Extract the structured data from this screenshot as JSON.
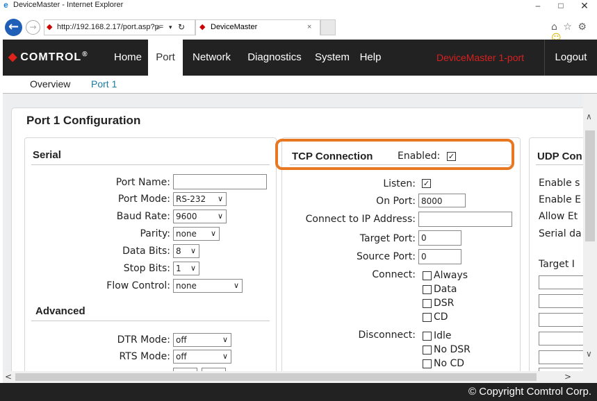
{
  "window": {
    "title": "DeviceMaster - Internet Explorer",
    "minimize": "–",
    "maximize": "□",
    "close": "✕"
  },
  "browser": {
    "url": "http://192.168.2.17/port.asp?p=",
    "search_glyph": "⌕",
    "dropdown_glyph": "▾",
    "refresh_glyph": "↻",
    "tab_label": "DeviceMaster",
    "tab_close": "×",
    "toolbar_icons": "⌂ ☆ ⚙"
  },
  "nav": {
    "logo": "COMTROL",
    "logo_sub": "®",
    "items": [
      {
        "label": "Home",
        "active": false
      },
      {
        "label": "Port",
        "active": true
      },
      {
        "label": "Network",
        "active": false
      },
      {
        "label": "Diagnostics",
        "active": false
      },
      {
        "label": "System",
        "active": false
      },
      {
        "label": "Help",
        "active": false
      }
    ],
    "device": "DeviceMaster 1-port",
    "logout": "Logout"
  },
  "subnav": {
    "overview": "Overview",
    "port": "Port 1"
  },
  "page": {
    "title": "Port 1 Configuration"
  },
  "serial": {
    "title": "Serial",
    "port_name_label": "Port Name:",
    "port_name_value": "",
    "port_mode_label": "Port Mode:",
    "port_mode_value": "RS-232",
    "baud_rate_label": "Baud Rate:",
    "baud_rate_value": "9600",
    "parity_label": "Parity:",
    "parity_value": "none",
    "data_bits_label": "Data Bits:",
    "data_bits_value": "8",
    "stop_bits_label": "Stop Bits:",
    "stop_bits_value": "1",
    "flow_control_label": "Flow Control:",
    "flow_control_value": "none",
    "advanced_title": "Advanced",
    "dtr_mode_label": "DTR Mode:",
    "dtr_mode_value": "off",
    "rts_mode_label": "RTS Mode:",
    "rts_mode_value": "off"
  },
  "tcp": {
    "title": "TCP Connection",
    "enabled_label": "Enabled:",
    "enabled": true,
    "listen_label": "Listen:",
    "listen": true,
    "on_port_label": "On Port:",
    "on_port_value": "8000",
    "connect_ip_label": "Connect to IP Address:",
    "connect_ip_value": "",
    "target_port_label": "Target Port:",
    "target_port_value": "0",
    "source_port_label": "Source Port:",
    "source_port_value": "0",
    "connect_label": "Connect:",
    "connect_options": [
      {
        "label": "Always",
        "checked": false
      },
      {
        "label": "Data",
        "checked": false
      },
      {
        "label": "DSR",
        "checked": false
      },
      {
        "label": "CD",
        "checked": false
      }
    ],
    "disconnect_label": "Disconnect:",
    "disconnect_options": [
      {
        "label": "Idle",
        "checked": false
      },
      {
        "label": "No DSR",
        "checked": false
      },
      {
        "label": "No CD",
        "checked": false
      }
    ]
  },
  "udp": {
    "title": "UDP Con",
    "lines": [
      "Enable s",
      "Enable E",
      "Allow Et",
      "Serial da"
    ],
    "target_label": "Target I"
  },
  "footer": {
    "copyright": "© Copyright Comtrol Corp."
  },
  "colors": {
    "highlight": "#e87722",
    "nav_bg": "#222222",
    "device_text": "#d92020",
    "subnav_link": "#1a7aa0"
  }
}
